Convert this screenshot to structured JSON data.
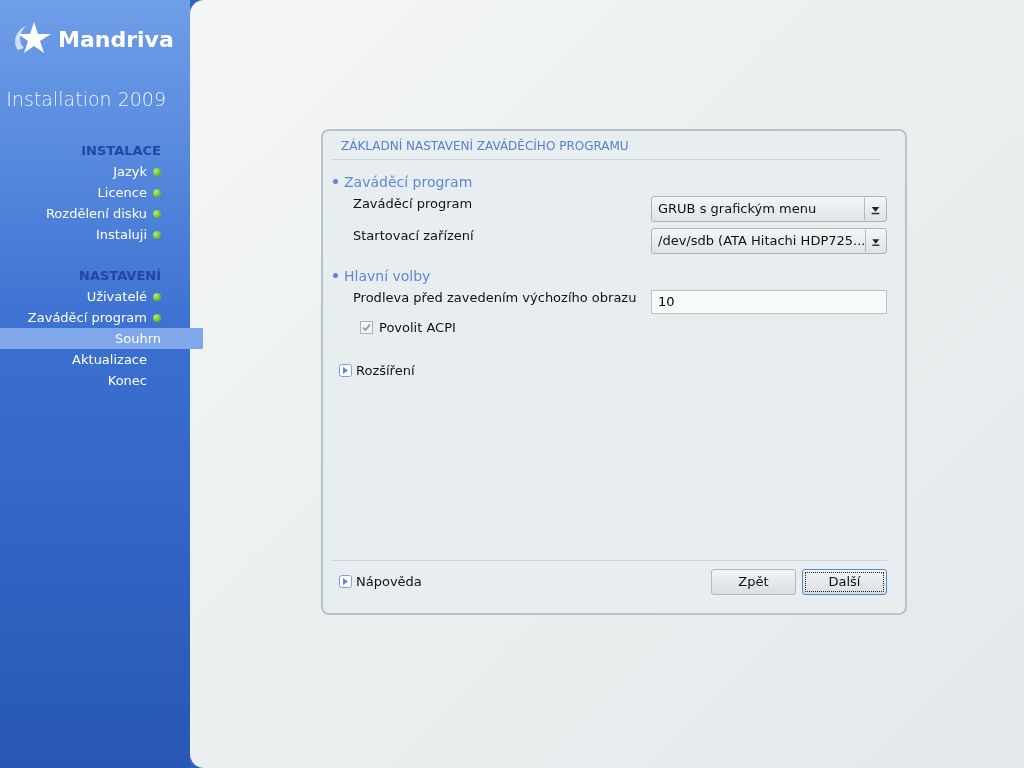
{
  "sidebar": {
    "logo": "Mandriva",
    "subtitle": "Installation 2009",
    "sections": [
      {
        "heading": "INSTALACE",
        "items": [
          {
            "label": "Jazyk",
            "done": true,
            "selected": false
          },
          {
            "label": "Licence",
            "done": true,
            "selected": false
          },
          {
            "label": "Rozdělení disku",
            "done": true,
            "selected": false
          },
          {
            "label": "Instaluji",
            "done": true,
            "selected": false
          }
        ]
      },
      {
        "heading": "NASTAVENÍ",
        "items": [
          {
            "label": "Uživatelé",
            "done": true,
            "selected": false
          },
          {
            "label": "Zaváděcí program",
            "done": true,
            "selected": false
          },
          {
            "label": "Souhrn",
            "done": false,
            "selected": true
          },
          {
            "label": "Aktualizace",
            "done": false,
            "selected": false
          },
          {
            "label": "Konec",
            "done": false,
            "selected": false
          }
        ]
      }
    ]
  },
  "panel": {
    "title": "ZÁKLADNÍ NASTAVENÍ ZAVÁDĚCÍHO PROGRAMU",
    "groups": [
      {
        "heading": "Zaváděcí program",
        "rows": [
          {
            "kind": "select",
            "label": "Zaváděcí program",
            "value": "GRUB s grafickým menu"
          },
          {
            "kind": "select",
            "label": "Startovací zařízení",
            "value": "/dev/sdb (ATA Hitachi HDP725..."
          }
        ]
      },
      {
        "heading": "Hlavní volby",
        "rows": [
          {
            "kind": "input",
            "label": "Prodleva před zavedením výchozího obrazu",
            "value": "10"
          },
          {
            "kind": "checkbox",
            "label": "Povolit ACPI",
            "checked": true
          }
        ]
      }
    ],
    "expander": {
      "label": "Rozšíření",
      "expanded": false
    },
    "help": {
      "label": "Nápověda",
      "expanded": false
    },
    "buttons": [
      {
        "label": "Zpět",
        "focused": false
      },
      {
        "label": "Další",
        "focused": true
      }
    ]
  }
}
